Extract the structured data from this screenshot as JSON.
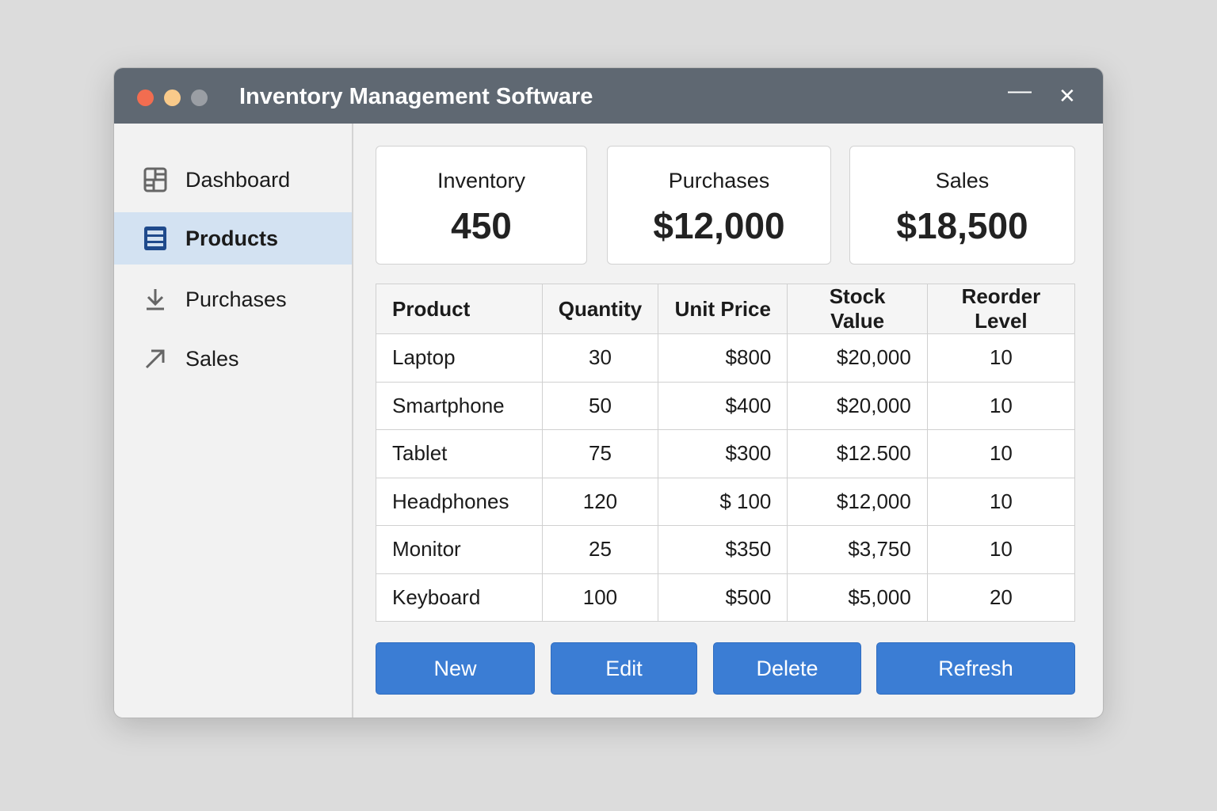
{
  "window": {
    "title": "Inventory Management Software",
    "minimize": "—",
    "close": "✕"
  },
  "sidebar": {
    "items": [
      {
        "label": "Dashboard",
        "icon": "dashboard-icon"
      },
      {
        "label": "Products",
        "icon": "list-icon",
        "active": true
      },
      {
        "label": "Purchases",
        "icon": "download-icon"
      },
      {
        "label": "Sales",
        "icon": "arrow-up-right-icon"
      }
    ]
  },
  "cards": [
    {
      "label": "Inventory",
      "value": "450"
    },
    {
      "label": "Purchases",
      "value": "$12,000"
    },
    {
      "label": "Sales",
      "value": "$18,500"
    }
  ],
  "table": {
    "headers": [
      "Product",
      "Quantity",
      "Unit Price",
      "Stock Value",
      "Reorder Level"
    ],
    "rows": [
      [
        "Laptop",
        "30",
        "$800",
        "$20,000",
        "10"
      ],
      [
        "Smartphone",
        "50",
        "$400",
        "$20,000",
        "10"
      ],
      [
        "Tablet",
        "75",
        "$300",
        "$12.500",
        "10"
      ],
      [
        "Headphones",
        "120",
        "$ 100",
        "$12,000",
        "10"
      ],
      [
        "Monitor",
        "25",
        "$350",
        "$3,750",
        "10"
      ],
      [
        "Keyboard",
        "100",
        "$500",
        "$5,000",
        "20"
      ]
    ]
  },
  "buttons": {
    "new": "New",
    "edit": "Edit",
    "delete": "Delete",
    "refresh": "Refresh"
  }
}
